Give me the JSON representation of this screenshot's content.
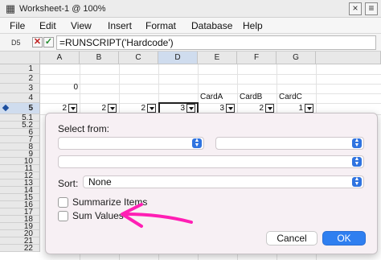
{
  "window": {
    "title": "Worksheet-1 @ 100%",
    "close_glyph": "×",
    "menu_glyph": "≡"
  },
  "menu": [
    "File",
    "Edit",
    "View",
    "Insert",
    "Format",
    "Database",
    "Help"
  ],
  "formula_bar": {
    "cell_ref": "D5",
    "formula": "=RUNSCRIPT('Hardcode')"
  },
  "columns": [
    "A",
    "B",
    "C",
    "D",
    "E",
    "F",
    "G"
  ],
  "selected_column": "D",
  "rows": [
    "1",
    "2",
    "3",
    "4",
    "5",
    "5.1",
    "5.2",
    "6",
    "7",
    "8",
    "9",
    "10",
    "11",
    "12",
    "13",
    "14",
    "15",
    "16",
    "17",
    "18",
    "19",
    "20",
    "21",
    "22"
  ],
  "selected_row": "5",
  "cells": {
    "A3": "0",
    "E4": "CardA",
    "F4": "CardB",
    "G4": "CardC",
    "A5": "2",
    "B5": "2",
    "C5": "2",
    "D5": "3",
    "E5": "3",
    "F5": "2",
    "G5": "1"
  },
  "dialog": {
    "select_from_label": "Select from:",
    "popup_1": "",
    "popup_2": "",
    "popup_3": "",
    "sort_label": "Sort:",
    "sort_value": "None",
    "summarize_items_label": "Summarize Items",
    "summarize_items_checked": false,
    "sum_values_label": "Sum Values",
    "sum_values_checked": false,
    "cancel_label": "Cancel",
    "ok_label": "OK"
  },
  "colors": {
    "accent": "#2f7ff0",
    "annotation_arrow": "#ff1fb4",
    "selected_header": "#cfdcee"
  },
  "icons": [
    "spreadsheet-icon",
    "cancel-x-icon",
    "accept-check-icon",
    "dropdown-arrow-icon",
    "stepper-icon",
    "annotation-arrow-icon",
    "close-icon",
    "menu-icon"
  ]
}
